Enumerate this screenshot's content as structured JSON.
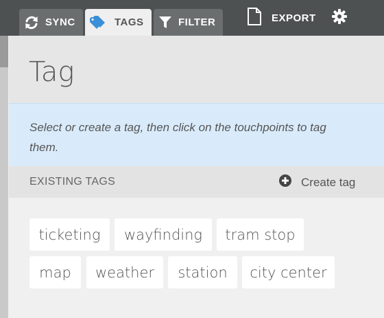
{
  "toolbar": {
    "tabs": [
      {
        "label": "SYNC",
        "icon": "sync-icon",
        "active": false
      },
      {
        "label": "TAGS",
        "icon": "tag-icon",
        "active": true
      },
      {
        "label": "FILTER",
        "icon": "filter-icon",
        "active": false
      }
    ],
    "export_label": "EXPORT",
    "export_icon": "document-icon",
    "settings_icon": "gear-icon"
  },
  "panel": {
    "title": "Tag",
    "info_text": "Select or create a tag, then click on the touchpoints to tag them.",
    "section_heading": "EXISTING TAGS",
    "create_label": "Create tag",
    "create_icon": "plus-circle-icon"
  },
  "tags": [
    "ticketing",
    "wayfinding",
    "tram stop",
    "map",
    "weather",
    "station",
    "city center"
  ],
  "colors": {
    "topbar": "#4d5152",
    "tab_inactive": "#6a6e6f",
    "tab_active": "#efefef",
    "info_background": "#d9ebfa",
    "tag_icon_active": "#3a8fd8"
  }
}
